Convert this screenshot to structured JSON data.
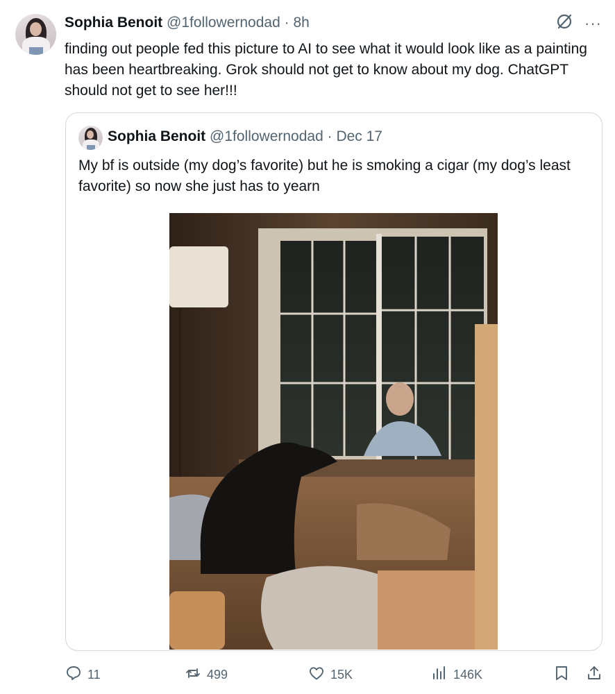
{
  "tweet": {
    "author_name": "Sophia Benoit",
    "handle": "@1followernodad",
    "time": "· 8h",
    "text": "finding out people fed this picture to AI to see what it would look like as a painting has been heartbreaking. Grok should not get to know about my dog. ChatGPT should not get to see her!!!"
  },
  "quoted_tweet": {
    "author_name": "Sophia Benoit",
    "handle": "@1followernodad",
    "time": "· Dec 17",
    "text": "My bf is outside (my dog’s favorite) but he is smoking a cigar (my dog’s least favorite) so now she just has to yearn"
  },
  "actions": {
    "replies": "11",
    "reposts": "499",
    "likes": "15K",
    "views": "146K"
  },
  "icons": {
    "top_right": [
      "grok-icon",
      "more-icon"
    ],
    "actions": [
      "reply-icon",
      "repost-icon",
      "like-icon",
      "views-icon",
      "bookmark-icon",
      "share-icon"
    ]
  },
  "colors": {
    "text_primary": "#0f1419",
    "text_secondary": "#536471",
    "border": "#cfd9de"
  }
}
